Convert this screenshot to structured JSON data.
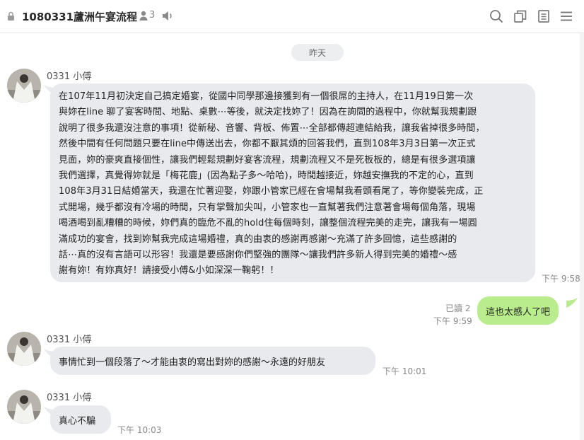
{
  "header": {
    "title": "1080331蘆洲午宴流程",
    "member_count": "3",
    "icons": [
      "lock-icon",
      "person-icon",
      "speaker-icon",
      "search-icon",
      "copy-icon",
      "notes-icon",
      "menu-icon"
    ]
  },
  "date_divider": "昨天",
  "messages": [
    {
      "sender": "0331 小傅",
      "lines": [
        "在107年11月初決定自己搞定婚宴，從國中同學那邊接獲到有一個很屌的主持人，在11月19日第一次",
        "與妳在line 聊了宴客時間、地點、桌數⋯等後，就決定找妳了！因為在詢問的過程中，你就幫我規劃跟",
        "說明了很多我還沒注意的事項！從新秘、音響、背板、佈置⋯全部都傳超連結給我，讓我省掉很多時間，",
        "然後中間有任何問題只要在line中傳送出去，你都不厭其煩的回答我們，直到108年3月3日第一次正式",
        "見面，妳的豪爽直接個性，讓我們輕鬆規劃好宴客流程，規劃流程又不是死板板的，總是有很多選項讓",
        "我們選擇，真覺得妳就是「梅花鹿」(因為點子多～哈哈)，時間越接近，妳越安撫我的不定的心，直到",
        "108年3月31日結婚當天，我還在忙著迎娶，妳跟小管家已經在會場幫我看頭看尾了，等你變裝完成，正",
        "式開場，幾乎都沒有冷場的時間，只有掌聲加尖叫，小管家也一直幫著我們注意著會場每個角落，現場",
        "喝酒喝到亂糟糟的時候，妳們真的臨危不亂的hold住每個時刻，讓整個流程完美的走完，讓我有一場圓",
        "滿成功的宴會，找到妳幫我完成這場婚禮，真的由衷的感謝再感謝～充滿了許多回憶，這些感謝的",
        "話⋯真的沒有言語可以形容！我還是要感謝你們堅強的團隊～讓我們許多新人得到完美的婚禮～感",
        "謝有妳！有妳真好！請接受小傅&小如深深一鞠躬！！"
      ],
      "time": "下午 9:58"
    },
    {
      "text": "這也太感人了吧",
      "read": "已讀 2",
      "time": "下午 9:59"
    },
    {
      "sender": "0331 小傅",
      "text": "事情忙到一個段落了～才能由衷的寫出對妳的感謝～永遠的好朋友",
      "time": "下午 10:01"
    },
    {
      "sender": "0331 小傅",
      "text": "真心不騙",
      "time": "下午 10:03"
    }
  ],
  "colors": {
    "incoming_bubble": "#e8eaee",
    "outgoing_bubble": "#b9ec8c",
    "header_text": "#2a2a2a",
    "icon_gray": "#7a7a7a"
  }
}
